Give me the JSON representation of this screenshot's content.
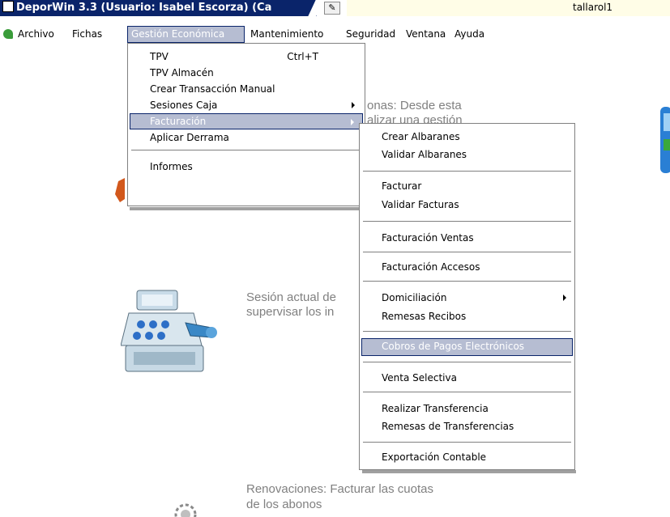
{
  "window": {
    "title": "DeporWin 3.3 (Usuario: Isabel Escorza) (Ca",
    "user_field": "tallarol1",
    "pin_icon": "pin-icon"
  },
  "menubar": {
    "items": [
      "Archivo",
      "Fichas",
      "Gestión Económica",
      "Mantenimiento",
      "Seguridad",
      "Ventana",
      "Ayuda"
    ],
    "selected": "Gestión Económica"
  },
  "content": {
    "abonos_line1": "onas: Desde esta",
    "abonos_line2": "alizar una gestión",
    "sesion_line1": "Sesión actual de",
    "sesion_line2": "supervisar los in",
    "renov_line1": "Renovaciones: Facturar las cuotas",
    "renov_line2": "de los abonos"
  },
  "menu_gestion": {
    "items": [
      {
        "label": "TPV",
        "shortcut": "Ctrl+T"
      },
      {
        "label": "TPV Almacén"
      },
      {
        "label": "Crear Transacción Manual"
      },
      {
        "label": "Sesiones Caja",
        "submenu": true
      },
      {
        "label": "Facturación",
        "submenu": true,
        "selected": true
      },
      {
        "label": "Aplicar Derrama"
      },
      {
        "label": "Informes"
      }
    ]
  },
  "menu_facturacion": {
    "items": [
      {
        "label": "Crear Albaranes"
      },
      {
        "label": "Validar Albaranes"
      },
      {
        "label": "Facturar"
      },
      {
        "label": "Validar Facturas"
      },
      {
        "label": "Facturación Ventas"
      },
      {
        "label": "Facturación Accesos"
      },
      {
        "label": "Domiciliación",
        "submenu": true
      },
      {
        "label": "Remesas Recibos"
      },
      {
        "label": "Cobros de Pagos Electrónicos",
        "selected": true
      },
      {
        "label": "Venta Selectiva"
      },
      {
        "label": "Realizar Transferencia"
      },
      {
        "label": "Remesas de Transferencias"
      },
      {
        "label": "Exportación Contable"
      }
    ]
  },
  "colors": {
    "title_bar": "#0a246a",
    "highlight": "#b6bdd2",
    "content_text": "#808080"
  }
}
